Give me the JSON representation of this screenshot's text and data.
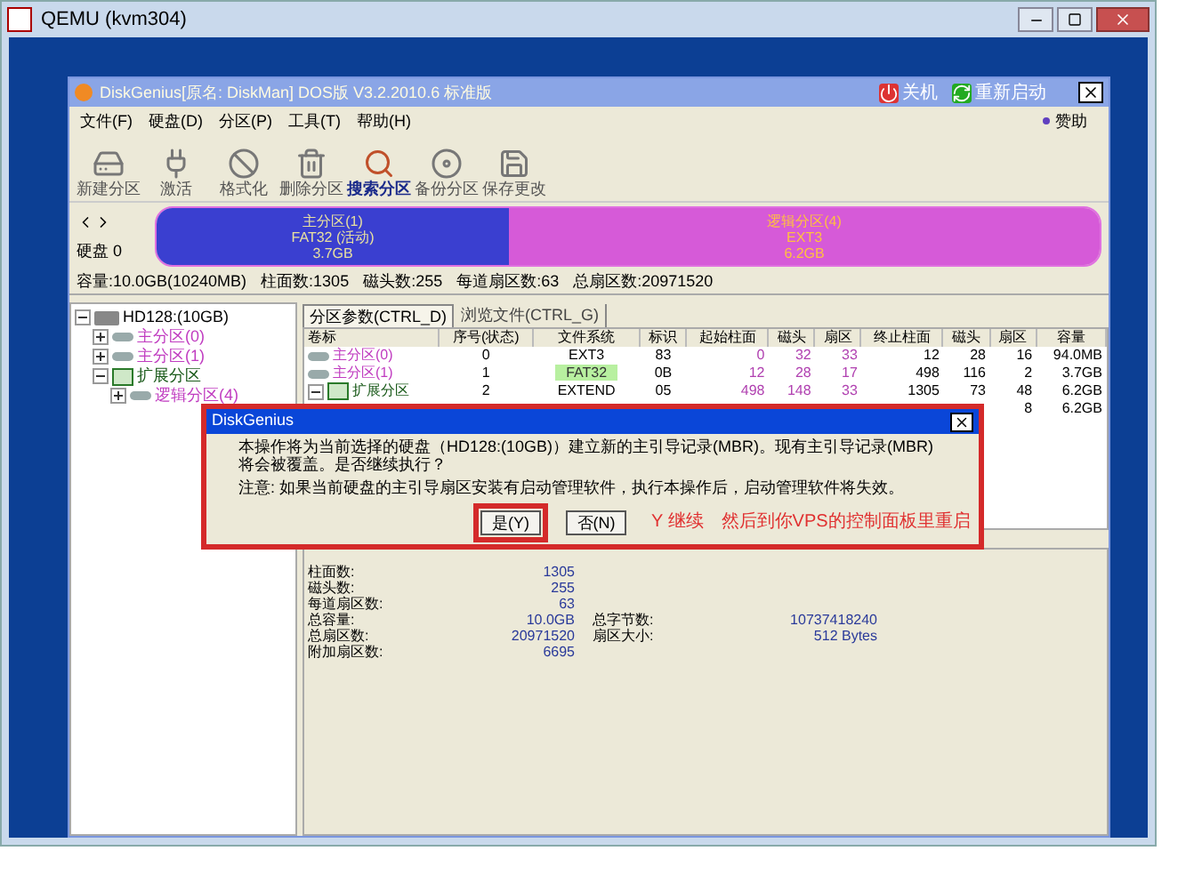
{
  "window": {
    "title": "QEMU (kvm304)"
  },
  "app": {
    "title": "DiskGenius[原名: DiskMan] DOS版 V3.2.2010.6 标准版",
    "actions": [
      "关机",
      "重新启动"
    ]
  },
  "menu": [
    "文件(F)",
    "硬盘(D)",
    "分区(P)",
    "工具(T)",
    "帮助(H)"
  ],
  "sponsor": "赞助",
  "toolbar": [
    {
      "label": "新建分区",
      "highlighted": false
    },
    {
      "label": "激活",
      "highlighted": false
    },
    {
      "label": "格式化",
      "highlighted": false
    },
    {
      "label": "删除分区",
      "highlighted": false
    },
    {
      "label": "搜索分区",
      "highlighted": true
    },
    {
      "label": "备份分区",
      "highlighted": false
    },
    {
      "label": "保存更改",
      "highlighted": false
    }
  ],
  "disk_map": {
    "label": "硬盘 0",
    "segments": [
      {
        "kind": "primary",
        "name": "主分区(1)",
        "fs": "FAT32 (活动)",
        "size": "3.7GB"
      },
      {
        "kind": "logical",
        "name": "逻辑分区(4)",
        "fs": "EXT3",
        "size": "6.2GB"
      }
    ]
  },
  "disk_info": [
    "容量:10.0GB(10240MB)",
    "柱面数:1305",
    "磁头数:255",
    "每道扇区数:63",
    "总扇区数:20971520"
  ],
  "tree": [
    {
      "label": "HD128:(10GB)",
      "kind": "disk",
      "expanded": true,
      "children": [
        {
          "label": "主分区(0)",
          "kind": "partition",
          "expanded": false
        },
        {
          "label": "主分区(1)",
          "kind": "partition",
          "expanded": false
        },
        {
          "label": "扩展分区",
          "kind": "extended",
          "expanded": true,
          "children": [
            {
              "label": "逻辑分区(4)",
              "kind": "partition",
              "expanded": false
            }
          ]
        }
      ]
    }
  ],
  "tabs": [
    {
      "label": "分区参数(CTRL_D)",
      "selected": true
    },
    {
      "label": "浏览文件(CTRL_G)",
      "selected": false
    }
  ],
  "table": {
    "columns": [
      "卷标",
      "序号(状态)",
      "文件系统",
      "标识",
      "起始柱面",
      "磁头",
      "扇区",
      "终止柱面",
      "磁头",
      "扇区",
      "容量"
    ],
    "rows": [
      {
        "kind": "primary",
        "active": false,
        "cells": [
          "主分区(0)",
          "0",
          "EXT3",
          "83",
          "0",
          "32",
          "33",
          "12",
          "28",
          "16",
          "94.0MB"
        ]
      },
      {
        "kind": "primary",
        "active": true,
        "cells": [
          "主分区(1)",
          "1",
          "FAT32",
          "0B",
          "12",
          "28",
          "17",
          "498",
          "116",
          "2",
          "3.7GB"
        ]
      },
      {
        "kind": "extended",
        "active": false,
        "cells": [
          "扩展分区",
          "2",
          "EXTEND",
          "05",
          "498",
          "148",
          "33",
          "1305",
          "73",
          "48",
          "6.2GB"
        ]
      },
      {
        "cells": [
          null,
          null,
          null,
          null,
          null,
          null,
          null,
          null,
          null,
          "8",
          "6.2GB"
        ]
      }
    ]
  },
  "details": [
    {
      "label": "柱面数:",
      "value": "1305"
    },
    {
      "label": "磁头数:",
      "value": "255"
    },
    {
      "label": "每道扇区数:",
      "value": "63"
    },
    {
      "label": "总容量:",
      "value": "10.0GB",
      "label_2": "总字节数:",
      "value_2": "10737418240"
    },
    {
      "label": "总扇区数:",
      "value": "20971520",
      "label_2": "扇区大小:",
      "value_2": "512 Bytes"
    },
    {
      "label": "附加扇区数:",
      "value": "6695"
    }
  ],
  "dialog": {
    "title": "DiskGenius",
    "message": "本操作将为当前选择的硬盘（HD128:(10GB)）建立新的主引导记录(MBR)。现有主引导记录(MBR)将会被覆盖。是否继续执行？",
    "note": "注意: 如果当前硬盘的主引导扇区安装有启动管理软件，执行本操作后，启动管理软件将失效。",
    "buttons": [
      {
        "label": "是(Y)",
        "circled": true
      },
      {
        "label": "否(N)",
        "circled": false
      }
    ],
    "annotations": [
      "Y 继续",
      "然后到你VPS的控制面板里重启"
    ]
  }
}
